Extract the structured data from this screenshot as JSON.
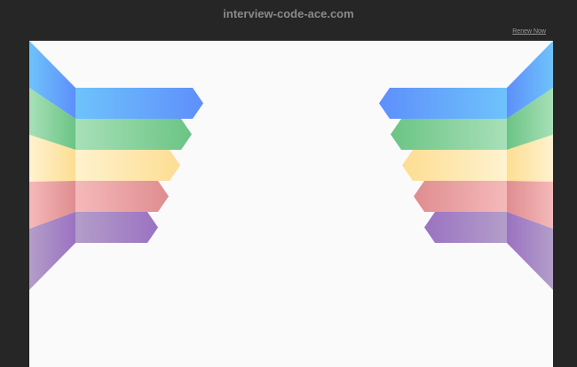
{
  "header": {
    "domain": "interview-code-ace.com",
    "renew_label": "Renew Now"
  },
  "ribbon_colors": [
    {
      "name": "blue",
      "light": "#6ec3fb",
      "dark": "#5e8ffb"
    },
    {
      "name": "green",
      "light": "#a8e0b8",
      "dark": "#6bc484"
    },
    {
      "name": "yellow",
      "light": "#fff2cf",
      "dark": "#fddd92"
    },
    {
      "name": "red",
      "light": "#f5b9ba",
      "dark": "#df8d8f"
    },
    {
      "name": "purple",
      "light": "#b39ec9",
      "dark": "#9b72c2"
    }
  ],
  "page_background": "#fafafb",
  "frame_background": "#262626"
}
